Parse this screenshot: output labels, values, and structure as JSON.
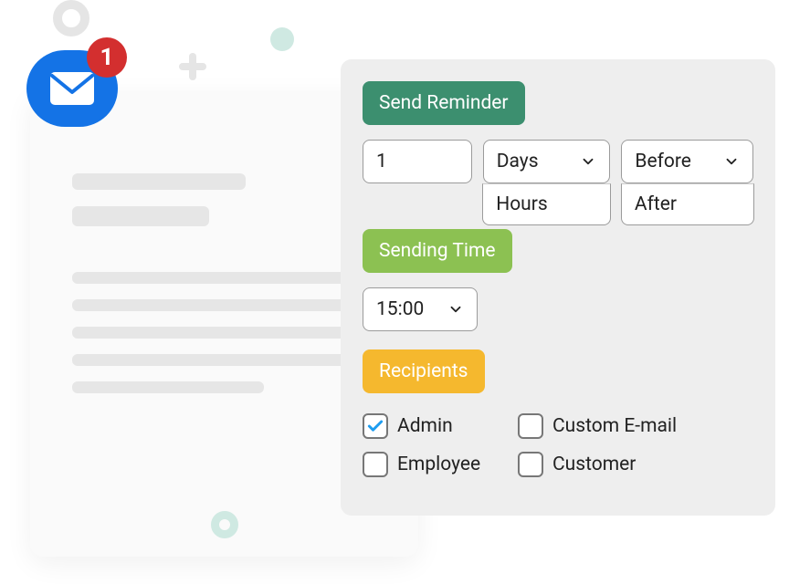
{
  "decor": {
    "notif_count": "1"
  },
  "panel": {
    "send_reminder_label": "Send Reminder",
    "quantity_value": "1",
    "unit": {
      "selected": "Days",
      "option": "Hours"
    },
    "relative": {
      "selected": "Before",
      "option": "After"
    },
    "sending_time_label": "Sending Time",
    "time_value": "15:00",
    "recipients_label": "Recipients",
    "recipients": {
      "admin": {
        "label": "Admin",
        "checked": true
      },
      "custom": {
        "label": "Custom E-mail",
        "checked": false
      },
      "employee": {
        "label": "Employee",
        "checked": false
      },
      "customer": {
        "label": "Customer",
        "checked": false
      }
    }
  }
}
